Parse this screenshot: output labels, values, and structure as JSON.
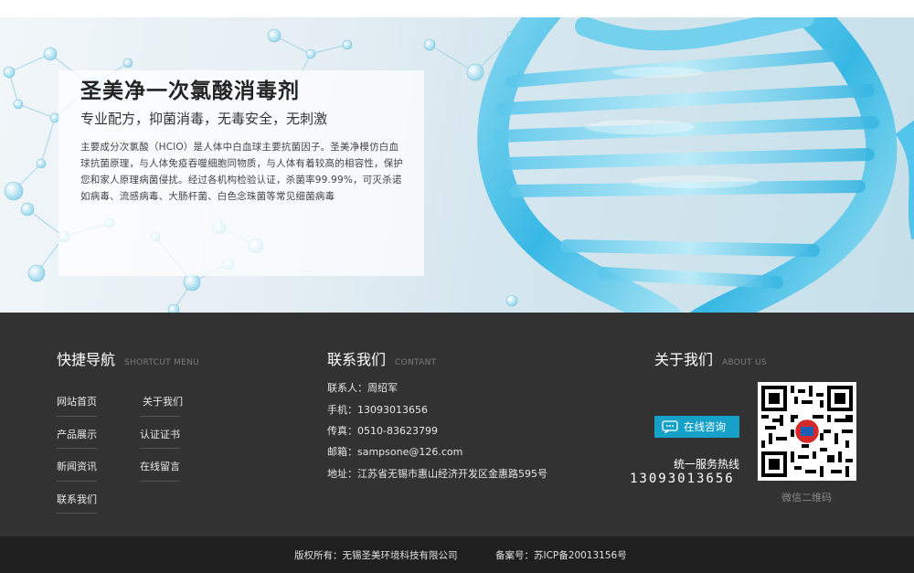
{
  "hero": {
    "title": "圣美净一次氯酸消毒剂",
    "subtitle": "专业配方，抑菌消毒，无毒安全，无刺激",
    "description": "主要成分次氯酸（HClO）是人体中白血球主要抗菌因子。圣美净模仿白血球抗菌原理，与人体免疫吞噬细胞同物质，与人体有着较高的相容性，保护您和家人原理病菌侵扰。经过各机构检验认证，杀菌率99.99%，可灭杀诺如病毒、流感病毒、大肠杆菌、白色念珠菌等常见细菌病毒"
  },
  "footer": {
    "nav": {
      "title": "快捷导航",
      "title_en": "SHORTCUT MENU",
      "items": [
        "网站首页",
        "关于我们",
        "产品展示",
        "认证证书",
        "新闻资讯",
        "在线留言",
        "联系我们"
      ]
    },
    "contact": {
      "title": "联系我们",
      "title_en": "CONTANT",
      "lines": [
        "联系人：周绍军",
        "手机：13093013656",
        "传真：0510-83623799",
        "邮箱：sampsone@126.com",
        "地址：江苏省无锡市惠山经济开发区金惠路595号"
      ]
    },
    "about": {
      "title": "关于我们",
      "title_en": "ABOUT US",
      "consult_label": "在线咨询",
      "hotline_label": "统一服务热线",
      "hotline_number": "13093013656",
      "qr_label": "微信二维码"
    }
  },
  "bottom": {
    "copyright": "版权所有：无锡圣美环境科技有限公司",
    "icp": "备案号：苏ICP备20013156号"
  },
  "colors": {
    "footer_bg": "#323232",
    "bottom_bg": "#1f1f1f",
    "accent": "#16a2c8"
  },
  "icons": [
    "chat-bubble-icon",
    "wechat-qr-code"
  ]
}
